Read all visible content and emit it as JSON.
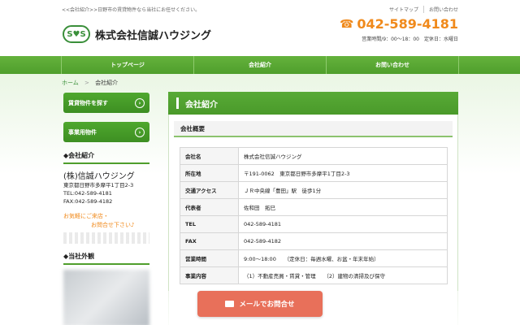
{
  "header": {
    "tagline": "<<会社紹介>>日野市の賃貸物件なら当社にお任せください。",
    "links": [
      "サイトマップ",
      "お問い合わせ"
    ],
    "logo_mark": "S♥S",
    "company_title": "株式会社信誠ハウジング",
    "phone": "042-589-4181",
    "hours": "営業時間/9：00～18：00　定休日：水曜日"
  },
  "nav": [
    "トップページ",
    "会社紹介",
    "お問い合わせ"
  ],
  "breadcrumb": {
    "home": "ホーム",
    "sep": ">",
    "current": "会社紹介"
  },
  "sidebar": {
    "buttons": [
      "賃貸物件を探す",
      "事業用物件"
    ],
    "company_heading": "◆会社紹介",
    "company_name": "(株)信誠ハウジング",
    "address": "東京都日野市多摩平1丁目2-3",
    "tel": "TEL:042-589-4181",
    "fax": "FAX:042-589-4182",
    "note_line1": "お気軽にご来店・",
    "note_line2": "お問合せ下さい♪",
    "exterior_heading": "◆当社外観"
  },
  "main": {
    "title": "会社紹介",
    "subheading": "会社概要",
    "rows": [
      {
        "label": "会社名",
        "value": "株式会社信誠ハウジング"
      },
      {
        "label": "所在地",
        "value": "〒191-0062　東京都日野市多摩平1丁目2-3"
      },
      {
        "label": "交通アクセス",
        "value": "ＪＲ中央線「豊田」駅　徒歩1分"
      },
      {
        "label": "代表者",
        "value": "佐和田　拓巳"
      },
      {
        "label": "TEL",
        "value": "042-589-4181"
      },
      {
        "label": "FAX",
        "value": "042-589-4182"
      },
      {
        "label": "営業時間",
        "value": "9:00～18:00　　（定休日：毎週水曜、お盆・年末年始）"
      },
      {
        "label": "事業内容",
        "value": "（1）不動産売買・賃貸・管理　　（2）建物の清掃及び保守"
      }
    ]
  },
  "mail_button": "メールでお問合せ",
  "colors": {
    "brand_green": "#4f9e2c",
    "accent_orange": "#f08a1c",
    "mail_button": "#e8705a"
  }
}
